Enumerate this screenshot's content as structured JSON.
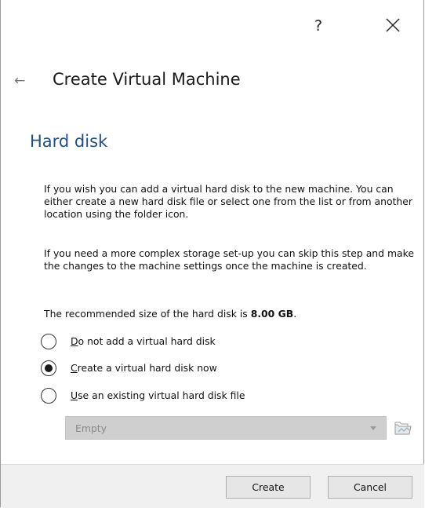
{
  "titlebar": {
    "help_label": "?",
    "close_icon": "close-icon"
  },
  "wizard": {
    "back_icon": "back-arrow-icon",
    "back_glyph": "←",
    "title": "Create Virtual Machine"
  },
  "page": {
    "heading": "Hard disk",
    "paragraph1": "If you wish you can add a virtual hard disk to the new machine. You can either create a new hard disk file or select one from the list or from another location using the folder icon.",
    "paragraph2": "If you need a more complex storage set-up you can skip this step and make the changes to the machine settings once the machine is created.",
    "recommended_prefix": "The recommended size of the hard disk is ",
    "recommended_size": "8.00 GB",
    "recommended_suffix": "."
  },
  "options": [
    {
      "mnemonic": "D",
      "rest": "o not add a virtual hard disk",
      "selected": false
    },
    {
      "mnemonic": "C",
      "rest": "reate a virtual hard disk now",
      "selected": true
    },
    {
      "mnemonic": "U",
      "rest": "se an existing virtual hard disk file",
      "selected": false
    }
  ],
  "disk_selector": {
    "value": "Empty",
    "enabled": false,
    "folder_icon": "folder-icon"
  },
  "footer": {
    "create_label": "Create",
    "cancel_label": "Cancel"
  },
  "colors": {
    "heading": "#1f4e8c",
    "disabled_combo": "#cfcfcf",
    "footer_bg": "#f0f0f0"
  }
}
